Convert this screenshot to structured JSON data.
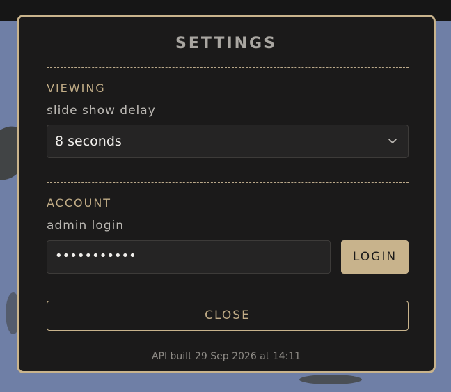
{
  "dialog": {
    "title": "SETTINGS"
  },
  "viewing": {
    "section_label": "VIEWING",
    "delay_label": "slide show delay",
    "delay_value": "8 seconds"
  },
  "account": {
    "section_label": "ACCOUNT",
    "login_label": "admin login",
    "password_value": "•••••••••••",
    "login_button": "LOGIN"
  },
  "close_button": "CLOSE",
  "footer": "API built 29 Sep 2026 at 14:11",
  "icons": {
    "select_chevron": "chevron-down-icon"
  },
  "colors": {
    "accent": "#c8b38c",
    "panel": "#1b1a1a",
    "input_bg": "#252424"
  }
}
